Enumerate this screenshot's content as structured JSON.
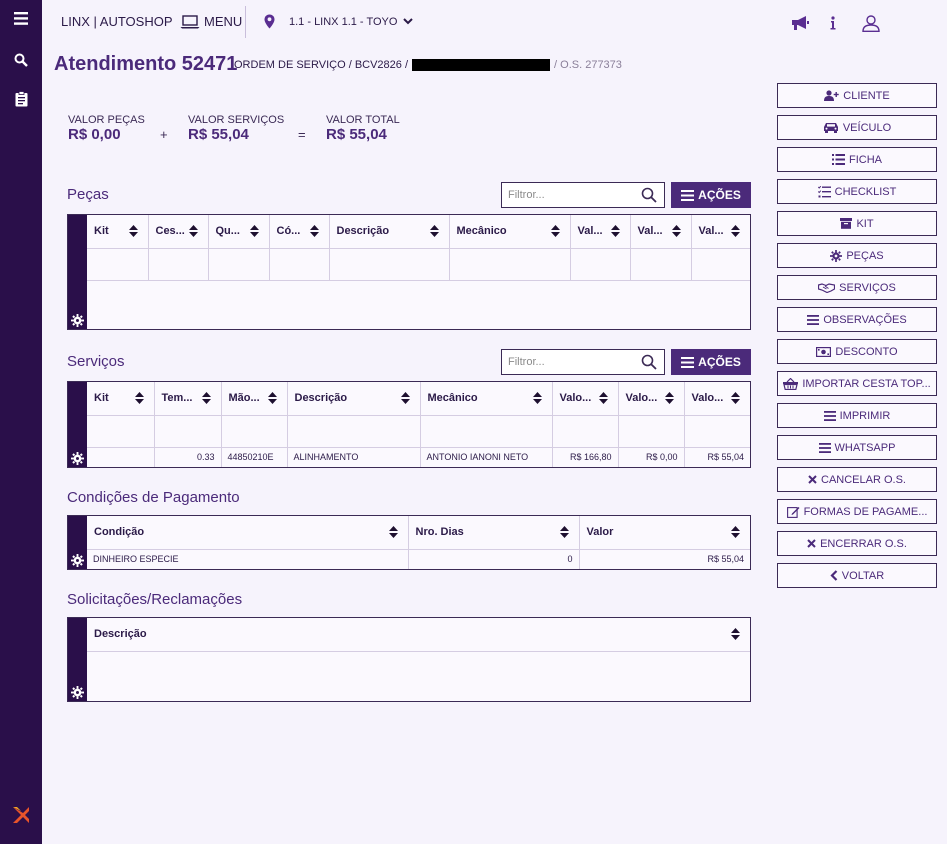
{
  "topbar": {
    "brand": "LINX | AUTOSHOP",
    "menu_label": "MENU",
    "location": "1.1 - LINX 1.1 - TOYO"
  },
  "header": {
    "title": "Atendimento 52471",
    "subtitle_prefix": "ORDEM DE SERVIÇO / BCV2826 /",
    "os_number": "/ O.S. 277373"
  },
  "totals": {
    "pecas_label": "VALOR PEÇAS",
    "pecas_value": "R$ 0,00",
    "plus": "+",
    "servicos_label": "VALOR SERVIÇOS",
    "servicos_value": "R$ 55,04",
    "equals": "=",
    "total_label": "VALOR TOTAL",
    "total_value": "R$ 55,04"
  },
  "common": {
    "filter_placeholder": "Filtror...",
    "acoes_label": "AÇÕES"
  },
  "pecas": {
    "title": "Peças",
    "columns": [
      "Kit",
      "Ces...",
      "Qu...",
      "Có...",
      "Descrição",
      "Mecânico",
      "Val...",
      "Val...",
      "Val..."
    ]
  },
  "servicos": {
    "title": "Serviços",
    "columns": [
      "Kit",
      "Tem...",
      "Mão...",
      "Descrição",
      "Mecânico",
      "Valo...",
      "Valo...",
      "Valo..."
    ],
    "rows": [
      [
        "",
        "0.33",
        "44850210E",
        "ALINHAMENTO",
        "ANTONIO IANONI NETO",
        "R$ 166,80",
        "R$ 0,00",
        "R$ 55,04"
      ]
    ]
  },
  "pagamento": {
    "title": "Condições de Pagamento",
    "columns": [
      "Condição",
      "Nro. Dias",
      "Valor"
    ],
    "rows": [
      [
        "DINHEIRO ESPECIE",
        "0",
        "R$ 55,04"
      ]
    ]
  },
  "solicitacoes": {
    "title": "Solicitações/Reclamações",
    "columns": [
      "Descrição"
    ]
  },
  "actions": {
    "cliente": "CLIENTE",
    "veiculo": "VEÍCULO",
    "ficha": "FICHA",
    "checklist": "CHECKLIST",
    "kit": "KIT",
    "pecas": "PEÇAS",
    "servicos": "SERVIÇOS",
    "observacoes": "OBSERVAÇÕES",
    "desconto": "DESCONTO",
    "importar": "IMPORTAR CESTA TOP...",
    "imprimir": "IMPRIMIR",
    "whatsapp": "WHATSAPP",
    "cancelar": "CANCELAR O.S.",
    "formas": "FORMAS DE PAGAME...",
    "encerrar": "ENCERRAR O.S.",
    "voltar": "VOLTAR"
  },
  "colors": {
    "sidebar": "#2a0f4a",
    "accent": "#4b2a7a",
    "background": "#f6f3fc"
  }
}
